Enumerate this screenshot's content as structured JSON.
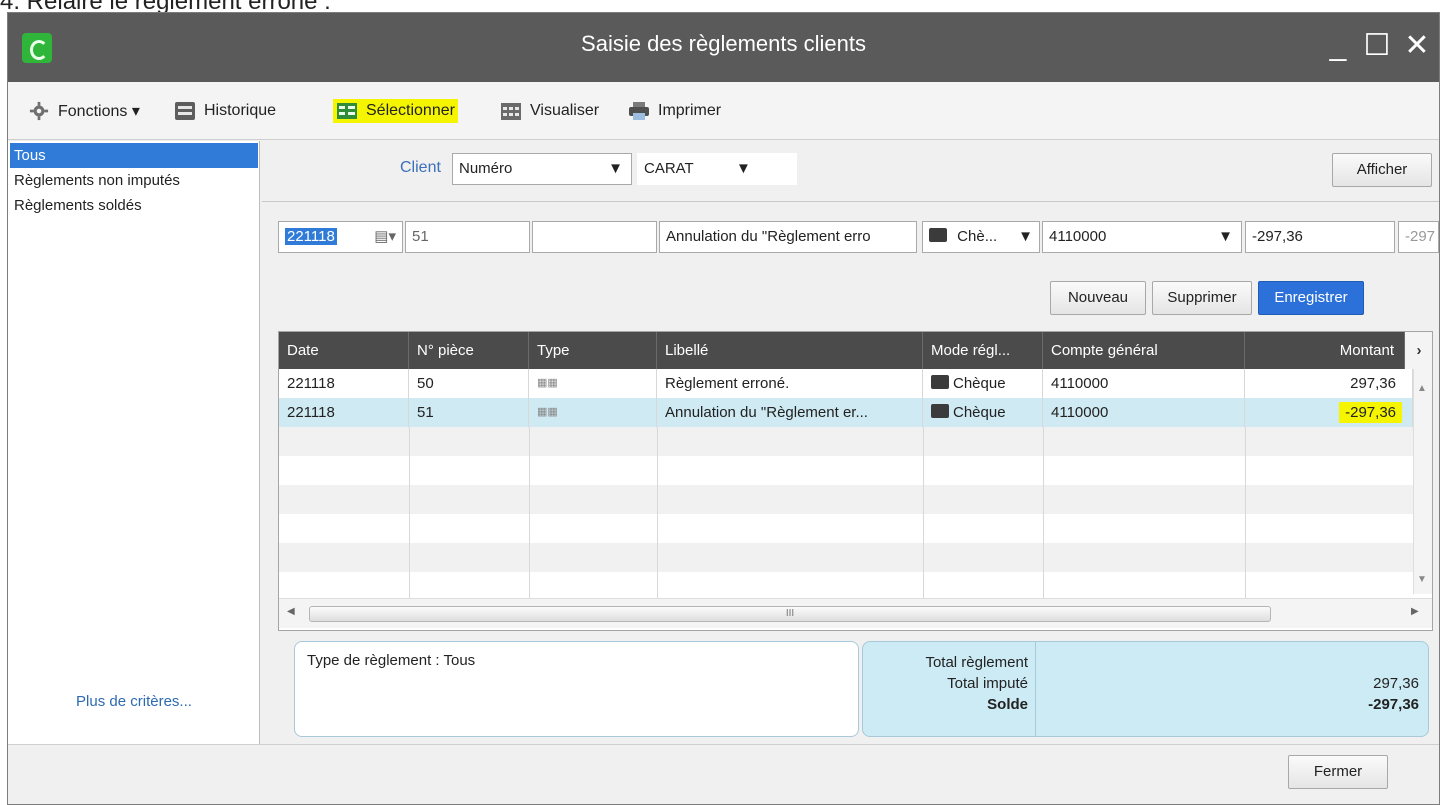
{
  "caption": "4. Relaire le règlement erroné :",
  "window": {
    "title": "Saisie des règlements clients",
    "controls": {
      "minimize": "_",
      "maximize": "☐",
      "close": "✕"
    }
  },
  "toolbar": {
    "functions_label": "Fonctions ▾",
    "history_label": "Historique",
    "select_label": "Sélectionner",
    "view_label": "Visualiser",
    "print_label": "Imprimer",
    "highlight_color": "#f5f500"
  },
  "sidebar": {
    "items": [
      {
        "label": "Tous",
        "selected": true
      },
      {
        "label": "Règlements non imputés",
        "selected": false
      },
      {
        "label": "Règlements soldés",
        "selected": false
      }
    ],
    "more_criteria": "Plus de critères..."
  },
  "filter": {
    "client_label": "Client",
    "client_mode": "Numéro",
    "client_value": "CARAT",
    "show_button": "Afficher"
  },
  "entry": {
    "date": "221118",
    "piece": "51",
    "blank": "",
    "libelle": "Annulation du \"Règlement erro",
    "mode": "Chè...",
    "account": "4110000",
    "amount": "-297,36",
    "amount_ghost": "-297"
  },
  "actions": {
    "new": "Nouveau",
    "delete": "Supprimer",
    "save": "Enregistrer"
  },
  "table": {
    "headers": [
      "Date",
      "N° pièce",
      "Type",
      "Libellé",
      "Mode régl...",
      "Compte général",
      "Montant"
    ],
    "rows": [
      {
        "date": "221118",
        "piece": "50",
        "type": "▦▦",
        "libelle": "Règlement erroné.",
        "mode": "Chèque",
        "account": "4110000",
        "amount": "297,36"
      },
      {
        "date": "221118",
        "piece": "51",
        "type": "▦▦",
        "libelle": "Annulation du \"Règlement er...",
        "mode": "Chèque",
        "account": "4110000",
        "amount": "-297,36"
      }
    ],
    "scroll_label": "III",
    "selected_row_color": "#cfeaf3"
  },
  "summary": {
    "type_label": "Type de règlement : Tous",
    "total_reglement_label": "Total règlement",
    "total_impute_label": "Total imputé",
    "solde_label": "Solde",
    "total_impute_value": "297,36",
    "solde_value": "-297,36"
  },
  "footer": {
    "close_button": "Fermer"
  }
}
